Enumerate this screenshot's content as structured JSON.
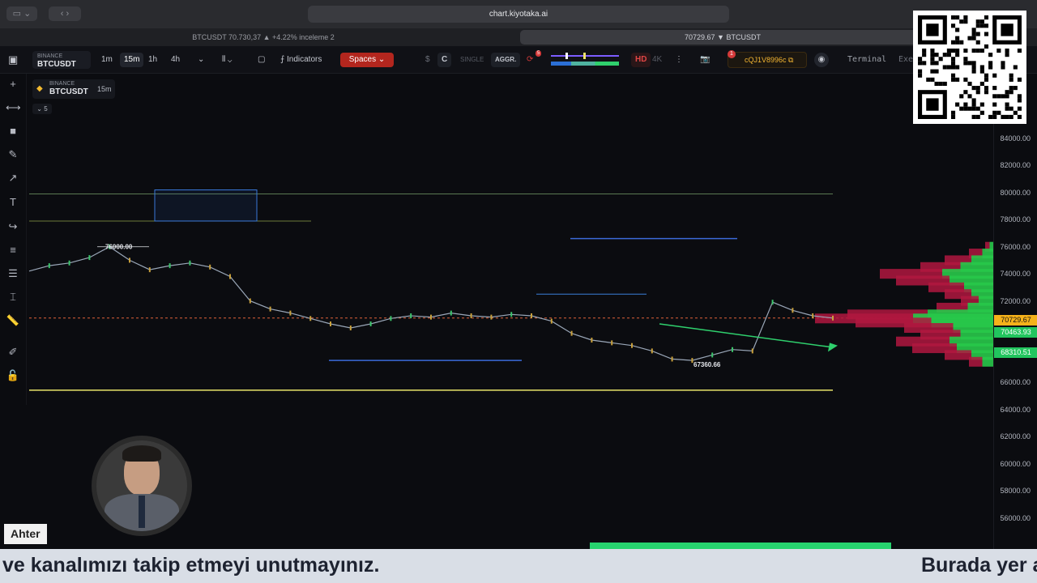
{
  "browser": {
    "url": "chart.kiyotaka.ai",
    "tabs": [
      {
        "label": "BTCUSDT 70.730,37 ▲ +4.22% inceleme 2"
      },
      {
        "label": "70729.67 ▼ BTCUSDT"
      }
    ]
  },
  "toolbar": {
    "exchange": "BINANCE",
    "symbol": "BTCUSDT",
    "timeframes": [
      "1m",
      "15m",
      "1h",
      "4h"
    ],
    "active_timeframe": "15m",
    "indicators_label": "Indicators",
    "spaces_label": "Spaces",
    "dollar_label": "$",
    "c_label": "C",
    "single_label": "SINGLE",
    "aggr_label": "AGGR.",
    "hd_label": "HD",
    "fourk_label": "4K",
    "account_id": "cQJ1V8996c",
    "terminal_label": "Terminal",
    "exec_label": "Exe",
    "notification_count": "1",
    "refresh_badge": "5"
  },
  "chart": {
    "badge_exchange": "BINANCE",
    "badge_symbol": "BTCUSDT",
    "badge_timeframe": "15m",
    "collapse_count": "5",
    "high_label": "76000.00",
    "low_label": "67360.66"
  },
  "price_axis": {
    "labels": [
      "84000.00",
      "82000.00",
      "80000.00",
      "78000.00",
      "76000.00",
      "74000.00",
      "72000.00",
      "66000.00",
      "64000.00",
      "62000.00",
      "60000.00",
      "58000.00",
      "56000.00"
    ],
    "current_price": "70729.67",
    "level_1": "70463.93",
    "level_2": "68310.51"
  },
  "chart_data": {
    "type": "line",
    "title": "",
    "xlabel": "",
    "ylabel": "",
    "ylim": [
      54000,
      86000
    ],
    "series": [
      {
        "name": "BTCUSDT",
        "values": [
          74200,
          74600,
          74800,
          75200,
          76000,
          75000,
          74300,
          74600,
          74800,
          74500,
          73800,
          72000,
          71400,
          71100,
          70700,
          70300,
          70000,
          70300,
          70700,
          70900,
          70800,
          71100,
          70900,
          70800,
          71000,
          70900,
          70500,
          69600,
          69100,
          68900,
          68700,
          68300,
          67700,
          67600,
          68000,
          68400,
          68300,
          71900,
          71300,
          70900,
          70729.67
        ]
      }
    ],
    "annotations": [
      "76000.00",
      "67360.66"
    ]
  },
  "overlay": {
    "name_tag": "Ahter",
    "ticker_left": "ve kanalımızı takip etmeyi unutmayınız.",
    "ticker_right": "Burada yer a"
  },
  "colors": {
    "accent_red": "#d63a3a",
    "price_tag": "#f6b21a",
    "green_tag": "#22c55e",
    "volume_red": "#b0173f",
    "volume_green": "#28c84a"
  }
}
